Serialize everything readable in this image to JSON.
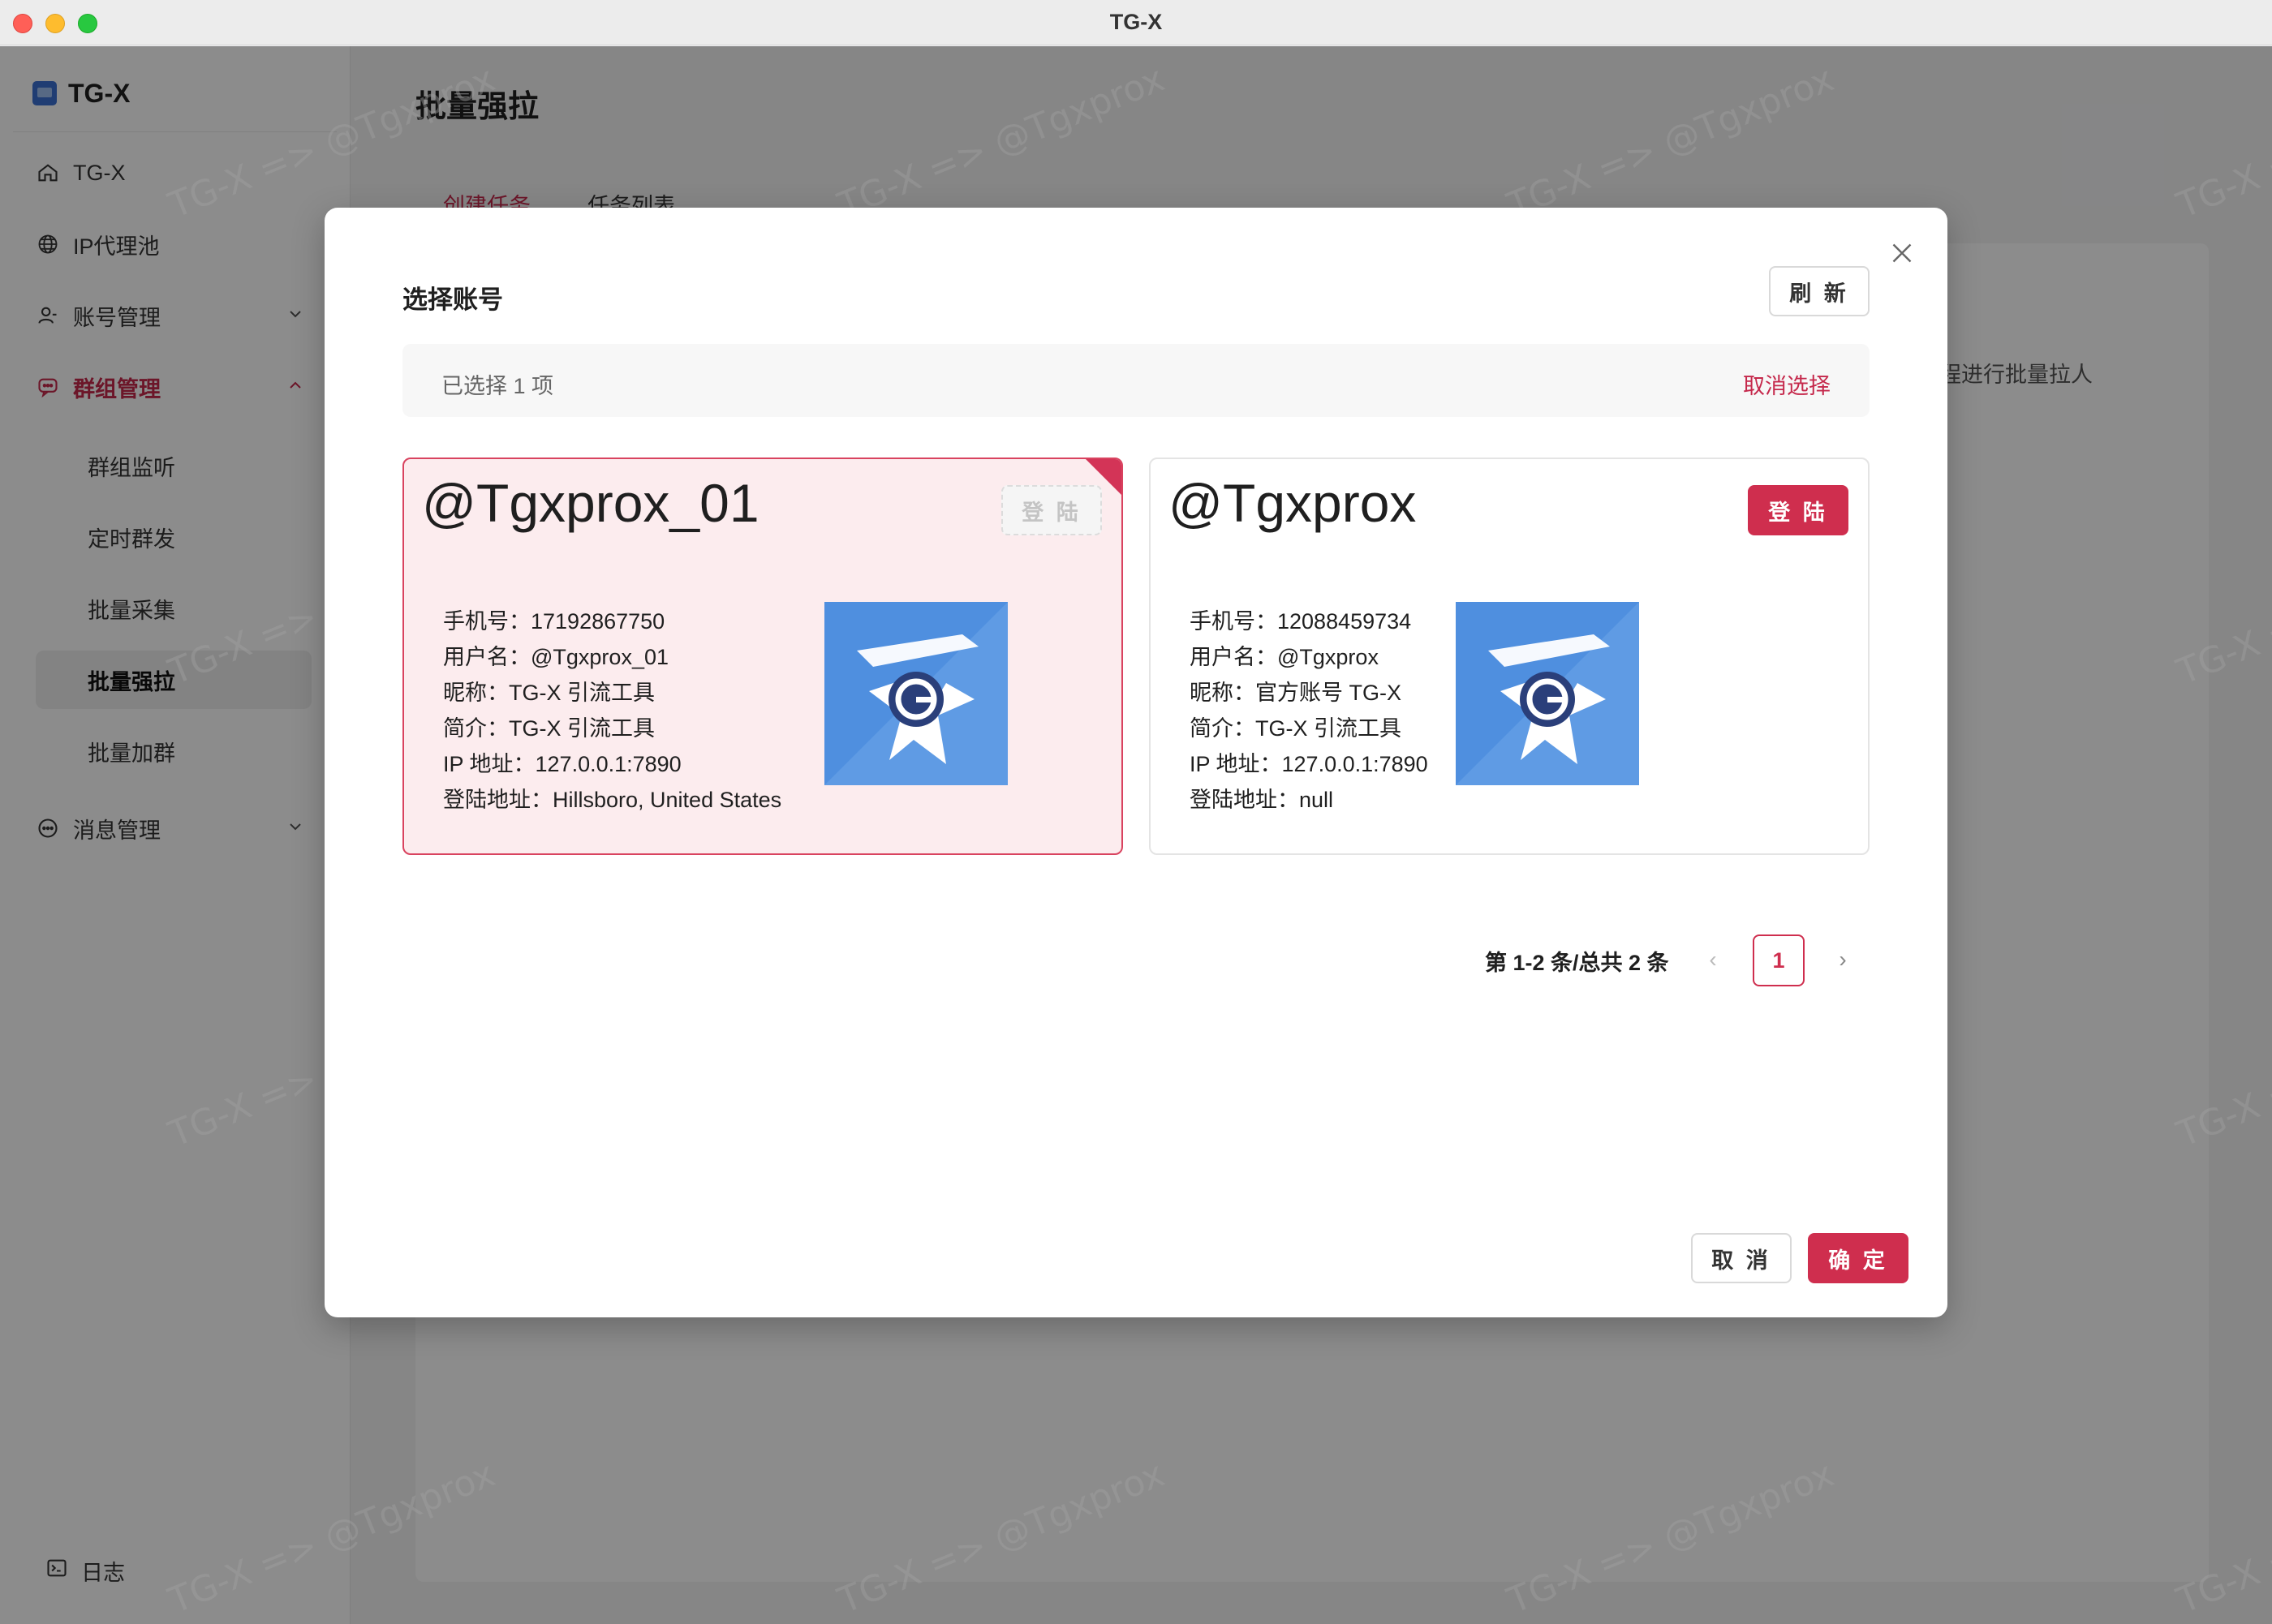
{
  "window": {
    "title": "TG-X"
  },
  "sidebar": {
    "brand": "TG-X",
    "items": [
      {
        "label": "TG-X",
        "icon": "home-icon"
      },
      {
        "label": "IP代理池",
        "icon": "globe-icon"
      },
      {
        "label": "账号管理",
        "icon": "user-icon"
      },
      {
        "label": "群组管理",
        "icon": "chat-group-icon"
      },
      {
        "label": "消息管理",
        "icon": "message-icon"
      }
    ],
    "group_sub_items": [
      "群组监听",
      "定时群发",
      "批量采集",
      "批量强拉",
      "批量加群"
    ],
    "log_label": "日志"
  },
  "main": {
    "title": "批量强拉",
    "tabs": [
      "创建任务",
      "任务列表"
    ],
    "hint": "程进行批量拉人"
  },
  "modal": {
    "title": "选择账号",
    "refresh_label": "刷 新",
    "selection": {
      "text": "已选择  1  项",
      "cancel_label": "取消选择"
    },
    "accounts": [
      {
        "handle": "@Tgxprox_01",
        "login_label": "登 陆",
        "selected": true,
        "lines": [
          "手机号：17192867750",
          "用户名：@Tgxprox_01",
          "昵称：TG-X 引流工具",
          "简介：TG-X 引流工具",
          "IP 地址：127.0.0.1:7890",
          "登陆地址：Hillsboro, United States"
        ]
      },
      {
        "handle": "@Tgxprox",
        "login_label": "登 陆",
        "selected": false,
        "lines": [
          "手机号：12088459734",
          "用户名：@Tgxprox",
          "昵称：官方账号 TG-X",
          "简介：TG-X 引流工具",
          "IP 地址：127.0.0.1:7890",
          "登陆地址：null"
        ]
      }
    ],
    "pagination": {
      "total_text": "第 1-2 条/总共 2 条",
      "current_page": "1",
      "prev": "‹",
      "next": "›"
    },
    "cancel_label": "取 消",
    "ok_label": "确 定"
  },
  "watermark": "TG-X => @Tgxprox",
  "colors": {
    "accent": "#cf2e4e",
    "selected_card_bg": "#fcecee",
    "overlay": "rgba(0,0,0,0.45)"
  }
}
